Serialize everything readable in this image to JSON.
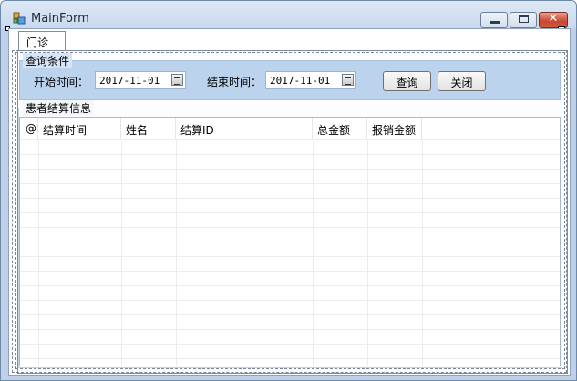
{
  "window": {
    "title": "MainForm",
    "icons": [
      "app-icon",
      "minimize-icon",
      "maximize-icon",
      "close-icon"
    ]
  },
  "tab": {
    "label": "门诊"
  },
  "query_group": {
    "legend": "查询条件",
    "start_label": "开始时间：",
    "start_value": "2017-11-01",
    "end_label": "结束时间：",
    "end_value": "2017-11-01",
    "query_button": "查询",
    "close_button": "关闭"
  },
  "result_group": {
    "legend": "患者结算信息"
  },
  "grid": {
    "columns": [
      "@",
      "结算时间",
      "姓名",
      "结算ID",
      "总金额",
      "报销金额"
    ],
    "rows": []
  },
  "colors": {
    "panel": "#bcd3ee",
    "close_button": "#c9452f",
    "title_bar": "#dfe9f5"
  }
}
